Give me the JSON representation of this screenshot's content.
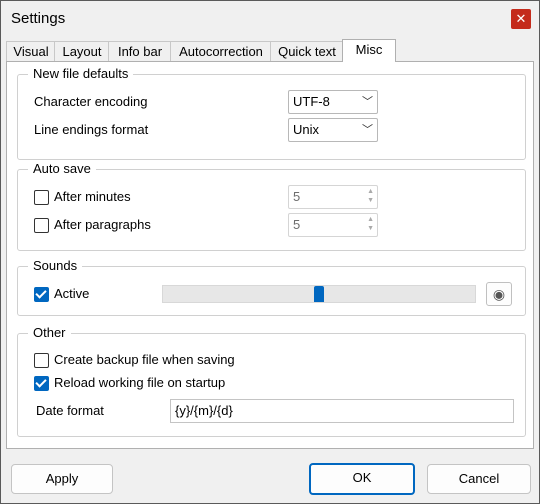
{
  "window": {
    "title": "Settings",
    "close_glyph": "✕"
  },
  "tabs": [
    "Visual",
    "Layout",
    "Info bar",
    "Autocorrection",
    "Quick text",
    "Misc"
  ],
  "active_tab": "Misc",
  "new_file_defaults": {
    "legend": "New file defaults",
    "encoding_label": "Character encoding",
    "encoding_value": "UTF-8",
    "line_endings_label": "Line endings format",
    "line_endings_value": "Unix"
  },
  "auto_save": {
    "legend": "Auto save",
    "minutes_label": "After minutes",
    "minutes_checked": false,
    "minutes_value": "5",
    "paragraphs_label": "After paragraphs",
    "paragraphs_checked": false,
    "paragraphs_value": "5"
  },
  "sounds": {
    "legend": "Sounds",
    "active_label": "Active",
    "active_checked": true,
    "volume_fraction": 0.5,
    "play_icon": "speaker-icon"
  },
  "other": {
    "legend": "Other",
    "backup_label": "Create backup file when saving",
    "backup_checked": false,
    "reload_label": "Reload working file on startup",
    "reload_checked": true,
    "date_format_label": "Date format",
    "date_format_value": "{y}/{m}/{d}"
  },
  "buttons": {
    "apply": "Apply",
    "ok": "OK",
    "cancel": "Cancel"
  },
  "colors": {
    "accent": "#0067c0",
    "close": "#c42b1c"
  }
}
